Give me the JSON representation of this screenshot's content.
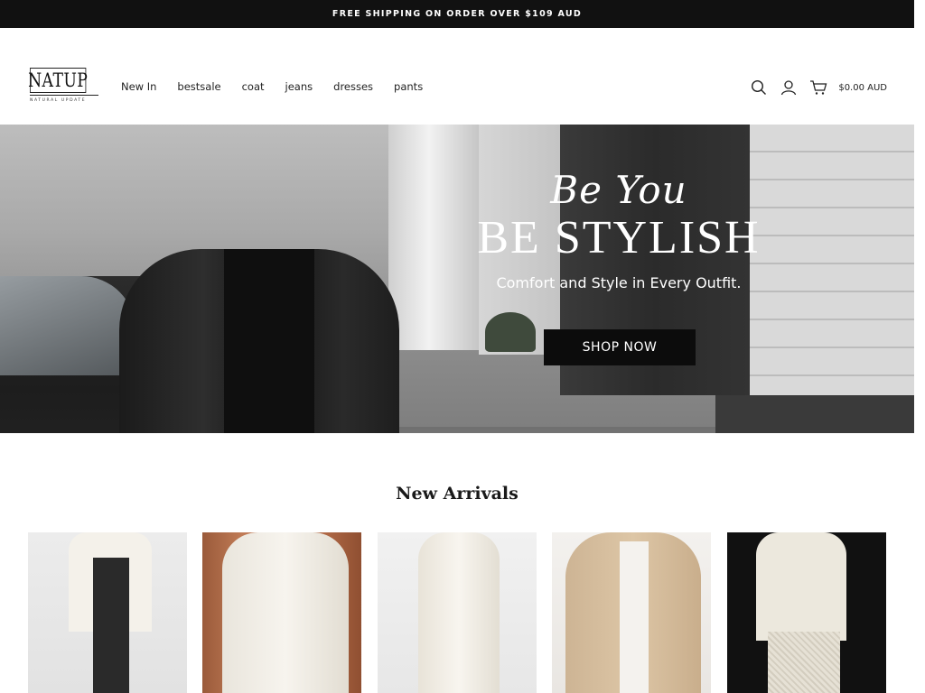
{
  "announcement": {
    "text": "FREE SHIPPING ON ORDER OVER $109 AUD"
  },
  "header": {
    "logo_text": "NATUP",
    "logo_tagline": "NATURAL UPDATE",
    "nav": [
      "New In",
      "bestsale",
      "coat",
      "jeans",
      "dresses",
      "pants"
    ],
    "icons": [
      "search-icon",
      "account-icon",
      "cart-icon"
    ],
    "cart_total": "$0.00 AUD"
  },
  "hero": {
    "script": "Be You",
    "headline": "BE STYLISH",
    "subheadline": "Comfort and Style in Every Outfit.",
    "cta": "SHOP NOW"
  },
  "new_arrivals": {
    "title": "New Arrivals"
  },
  "colors": {
    "announcement_bg": "#111111",
    "cta_bg": "#0c0c0c",
    "text": "#1a1a1a"
  }
}
